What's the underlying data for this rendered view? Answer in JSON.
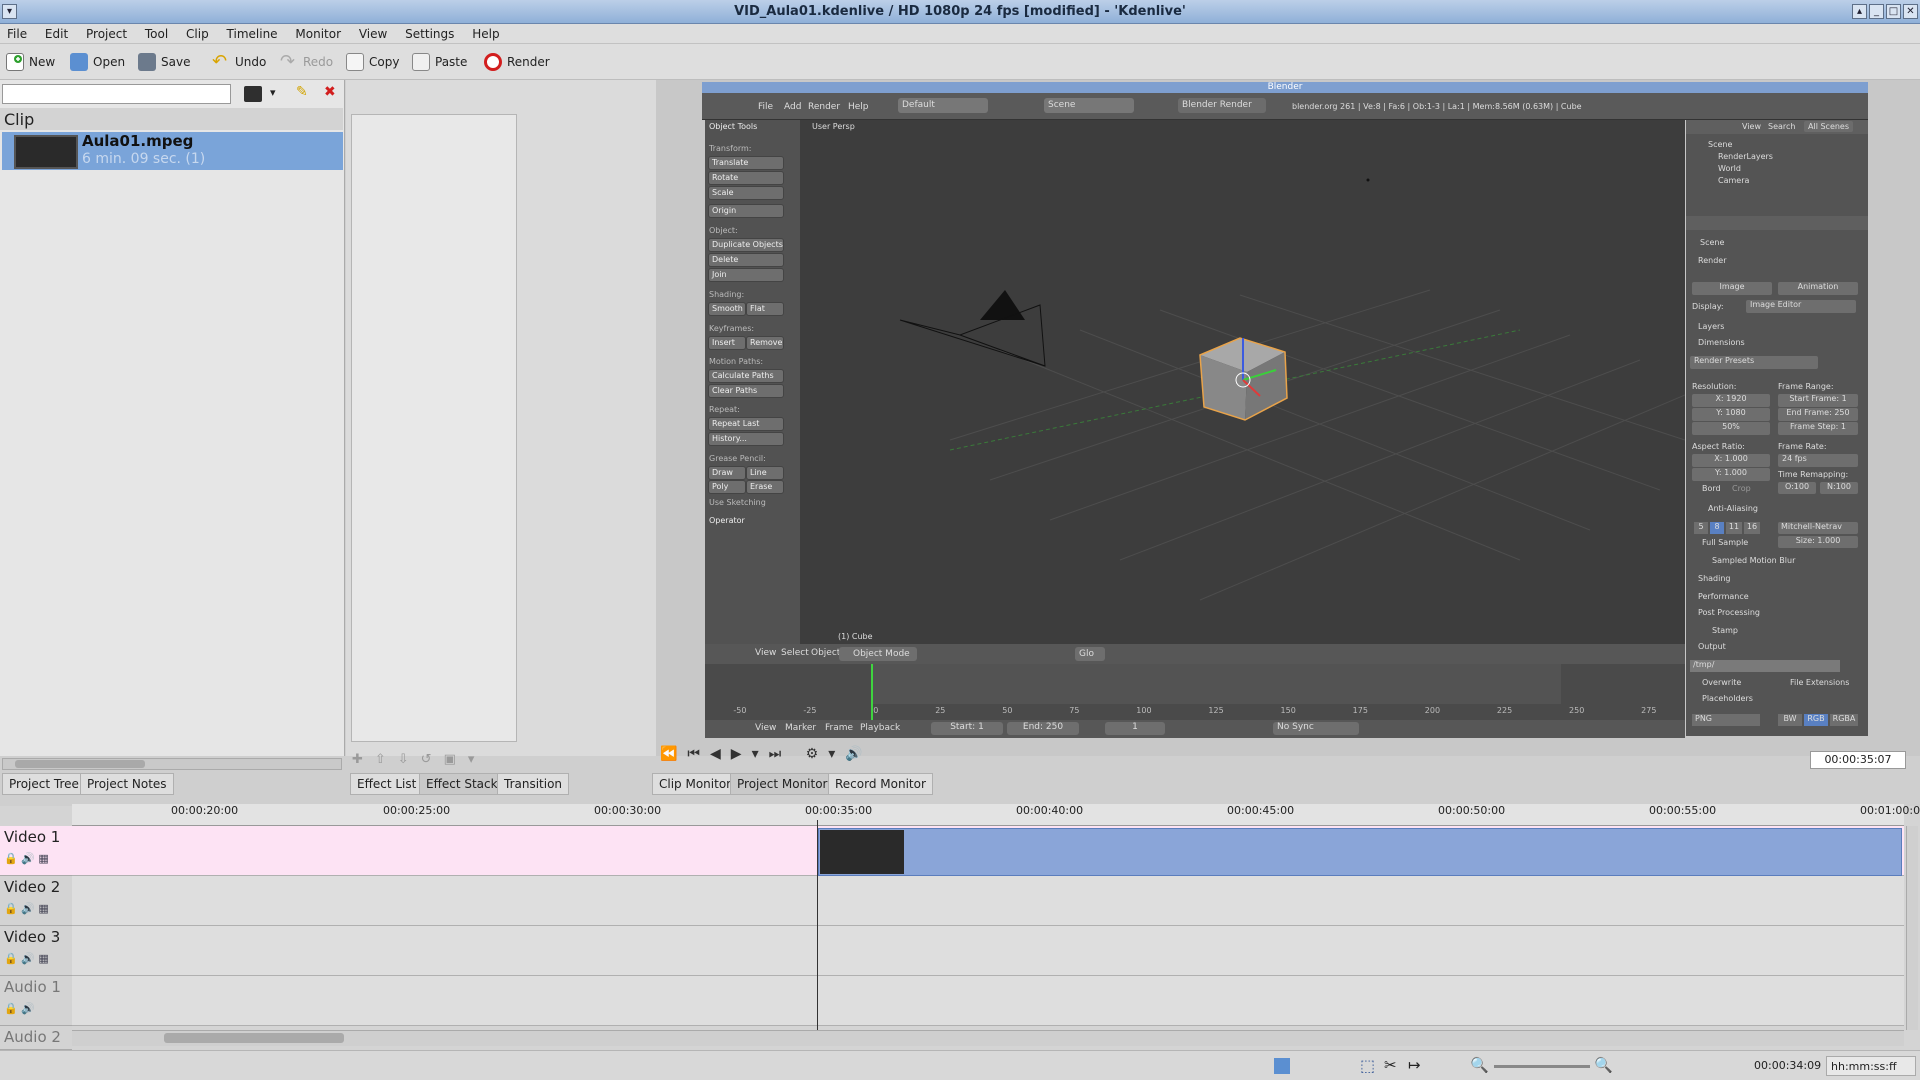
{
  "window": {
    "title": "VID_Aula01.kdenlive / HD 1080p 24 fps [modified] - 'Kdenlive'"
  },
  "menu": [
    "File",
    "Edit",
    "Project",
    "Tool",
    "Clip",
    "Timeline",
    "Monitor",
    "View",
    "Settings",
    "Help"
  ],
  "toolbar": {
    "new": "New",
    "open": "Open",
    "save": "Save",
    "undo": "Undo",
    "redo": "Redo",
    "copy": "Copy",
    "paste": "Paste",
    "render": "Render"
  },
  "project": {
    "header": "Clip",
    "clip": {
      "name": "Aula01.mpeg",
      "duration": "6 min. 09 sec. (1)"
    },
    "tabs": [
      "Project Tree",
      "Project Notes"
    ]
  },
  "effects": {
    "tabs": [
      "Effect List",
      "Effect Stack",
      "Transition"
    ]
  },
  "monitor": {
    "tabs": [
      "Clip Monitor",
      "Project Monitor",
      "Record Monitor"
    ],
    "timecode": "00:00:35:07"
  },
  "blender": {
    "title": "Blender",
    "menu": [
      "File",
      "Add",
      "Render",
      "Help"
    ],
    "layout": "Default",
    "scene": "Scene",
    "engine": "Blender Render",
    "info": "blender.org 261 | Ve:8 | Fa:6 | Ob:1-3 | La:1 | Mem:8.56M (0.63M) | Cube",
    "viewport_label": "User Persp",
    "object_label": "(1) Cube",
    "tools": {
      "panel": "Object Tools",
      "transform_label": "Transform:",
      "transform": [
        "Translate",
        "Rotate",
        "Scale"
      ],
      "origin": "Origin",
      "object_label": "Object:",
      "object": [
        "Duplicate Objects",
        "Delete",
        "Join"
      ],
      "shading_label": "Shading:",
      "shading": [
        "Smooth",
        "Flat"
      ],
      "keyframes_label": "Keyframes:",
      "keyframes": [
        "Insert",
        "Remove"
      ],
      "motion_label": "Motion Paths:",
      "motion": [
        "Calculate Paths",
        "Clear Paths"
      ],
      "repeat_label": "Repeat:",
      "repeat": [
        "Repeat Last",
        "History..."
      ],
      "grease_label": "Grease Pencil:",
      "grease": [
        "Draw",
        "Line",
        "Poly",
        "Erase"
      ],
      "sketch": "Use Sketching",
      "operator": "Operator"
    },
    "outliner": {
      "view": "View",
      "search": "Search",
      "all": "All Scenes",
      "items": [
        "Scene",
        "RenderLayers",
        "World",
        "Camera"
      ]
    },
    "properties": {
      "scene": "Scene",
      "render": "Render",
      "image": "Image",
      "animation": "Animation",
      "display_label": "Display:",
      "display_value": "Image Editor",
      "layers": "Layers",
      "dimensions": "Dimensions",
      "presets": "Render Presets",
      "resolution_label": "Resolution:",
      "res_x": "X: 1920",
      "res_y": "Y: 1080",
      "res_pct": "50%",
      "frame_range_label": "Frame Range:",
      "start_frame": "Start Frame: 1",
      "end_frame": "End Frame: 250",
      "frame_step": "Frame Step: 1",
      "aspect_label": "Aspect Ratio:",
      "aspect_x": "X: 1.000",
      "aspect_y": "Y: 1.000",
      "frame_rate_label": "Frame Rate:",
      "frame_rate": "24 fps",
      "remap_label": "Time Remapping:",
      "remap_old": "O:100",
      "remap_new": "N:100",
      "border": "Bord",
      "crop": "Crop",
      "aa": "Anti-Aliasing",
      "aa_samples": [
        "5",
        "8",
        "11",
        "16"
      ],
      "aa_filter": "Mitchell-Netrav",
      "full_sample": "Full Sample",
      "aa_size": "Size: 1.000",
      "smb": "Sampled Motion Blur",
      "shading": "Shading",
      "performance": "Performance",
      "post": "Post Processing",
      "stamp": "Stamp",
      "output": "Output",
      "output_path": "/tmp/",
      "overwrite": "Overwrite",
      "file_ext": "File Extensions",
      "placeholders": "Placeholders",
      "format": "PNG",
      "bw": "BW",
      "rgb": "RGB",
      "rgba": "RGBA"
    },
    "view_menu": [
      "View",
      "Select",
      "Object"
    ],
    "mode": "Object Mode",
    "pivot": "Glo",
    "timeline_menu": [
      "View",
      "Marker",
      "Frame",
      "Playback"
    ],
    "start": "Start: 1",
    "end": "End: 250",
    "current": "1",
    "sync": "No Sync",
    "frame_ticks": [
      "-50",
      "-25",
      "0",
      "25",
      "50",
      "75",
      "100",
      "125",
      "150",
      "175",
      "200",
      "225",
      "250",
      "275"
    ]
  },
  "timeline": {
    "ruler": [
      "00:00:20:00",
      "00:00:25:00",
      "00:00:30:00",
      "00:00:35:00",
      "00:00:40:00",
      "00:00:45:00",
      "00:00:50:00",
      "00:00:55:00",
      "00:01:00:00"
    ],
    "tracks": [
      "Video 1",
      "Video 2",
      "Video 3",
      "Audio 1",
      "Audio 2"
    ]
  },
  "status": {
    "timecode": "00:00:34:09",
    "format": "hh:mm:ss:ff"
  },
  "colors": {
    "accent": "#7aa4d9",
    "track_pink": "#fde3f4",
    "clip_blue": "#8aa5d8"
  }
}
